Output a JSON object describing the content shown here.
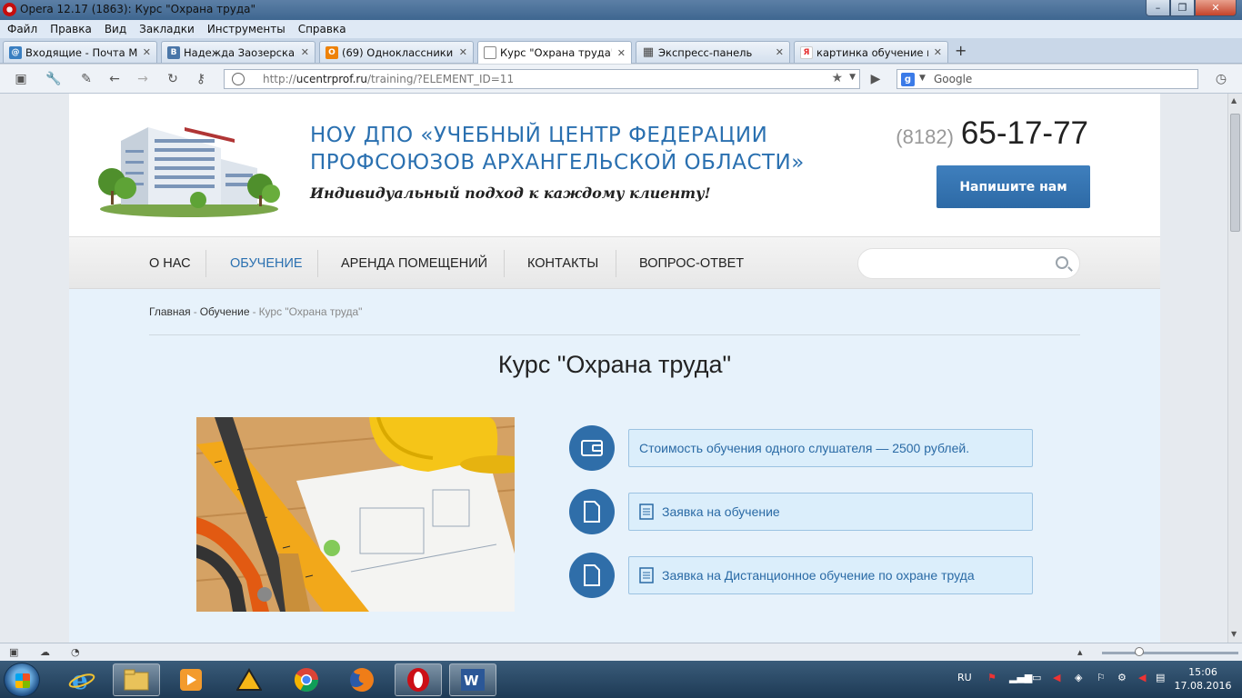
{
  "window": {
    "title": "Opera 12.17 (1863): Курс \"Охрана труда\"",
    "buttons": [
      "–",
      "❐",
      "✕"
    ]
  },
  "menu": [
    "Файл",
    "Правка",
    "Вид",
    "Закладки",
    "Инструменты",
    "Справка"
  ],
  "tabs": [
    {
      "label": "Входящие - Почта Mai...",
      "icon": "mail-icon",
      "color": "#3a7fc1",
      "glyph": "@"
    },
    {
      "label": "Надежда Заозерская",
      "icon": "vk-icon",
      "color": "#4a76a8",
      "glyph": "B"
    },
    {
      "label": "(69) Одноклассники",
      "icon": "ok-icon",
      "color": "#ee8208",
      "glyph": "O"
    },
    {
      "label": "Курс \"Охрана труда\"",
      "icon": "page-icon",
      "color": "#ffffff",
      "glyph": ""
    },
    {
      "label": "Экспресс-панель",
      "icon": "speed-dial-icon",
      "color": "#555555",
      "glyph": "▦"
    },
    {
      "label": "картинка обучение по...",
      "icon": "yandex-icon",
      "color": "#e62e2e",
      "glyph": "Я"
    }
  ],
  "new_tab": "+",
  "address": {
    "scheme": "http://",
    "host": "ucentrprof.ru",
    "path": "/training/?ELEMENT_ID=11",
    "search_placeholder": "Google"
  },
  "site": {
    "org_line1": "НОУ ДПО «УЧЕБНЫЙ ЦЕНТР ФЕДЕРАЦИИ",
    "org_line2": "ПРОФСОЮЗОВ АРХАНГЕЛЬСКОЙ ОБЛАСТИ»",
    "slogan": "Индивидуальный подход к каждому клиенту!",
    "phone_code": "(8182)",
    "phone_number": "65-17-77",
    "cta_label": "Напишите нам",
    "nav": [
      {
        "label": "О НАС",
        "active": false
      },
      {
        "label": "ОБУЧЕНИЕ",
        "active": true
      },
      {
        "label": "АРЕНДА ПОМЕЩЕНИЙ",
        "active": false
      },
      {
        "label": "КОНТАКТЫ",
        "active": false
      },
      {
        "label": "ВОПРОС-ОТВЕТ",
        "active": false
      }
    ],
    "breadcrumbs": {
      "home": "Главная",
      "sep": "-",
      "section": "Обучение",
      "current": "Курс \"Охрана труда\""
    },
    "page_title": "Курс \"Охрана труда\"",
    "info": [
      {
        "text": "Стоимость обучения одного слушателя — 2500 рублей.",
        "icon": "wallet-icon"
      },
      {
        "text": "Заявка на обучение",
        "icon": "document-icon"
      },
      {
        "text": "Заявка на Дистанционное обучение по охране труда",
        "icon": "document-icon"
      }
    ],
    "accent_color": "#2a70b0"
  },
  "taskbar": {
    "language": "RU",
    "time": "15:06",
    "date": "17.08.2016"
  }
}
